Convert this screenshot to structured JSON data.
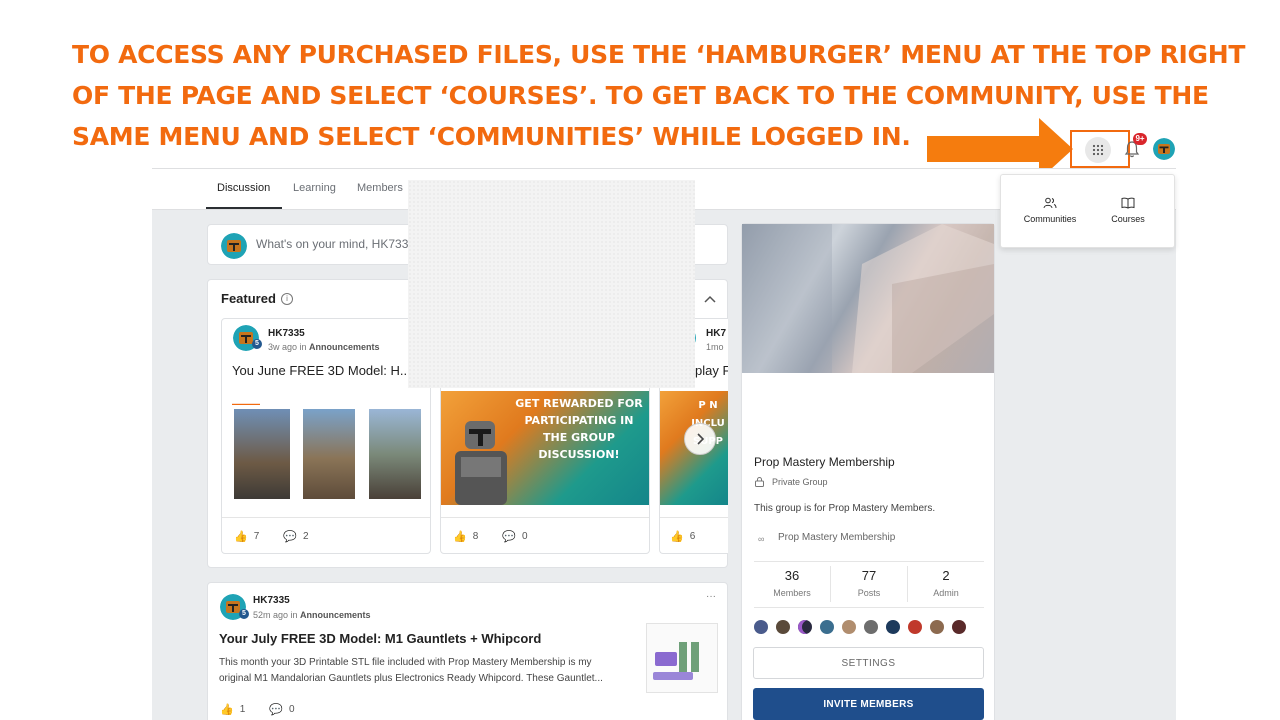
{
  "instruction": {
    "lines": [
      "TO ACCESS ANY PURCHASED FILES, USE THE ‘HAMBURGER’ MENU AT THE TOP RIGHT",
      "OF THE PAGE AND SELECT ‘COURSES’. TO GET BACK TO THE COMMUNITY, USE THE",
      "SAME MENU AND SELECT ‘COMMUNITIES’ WHILE LOGGED IN."
    ],
    "color": "#f26a0f"
  },
  "header": {
    "notification_count": "9+",
    "icons": [
      "apps-grid-icon",
      "bell-icon",
      "avatar"
    ]
  },
  "dropdown": {
    "items": [
      {
        "label": "Communities",
        "icon": "people-icon"
      },
      {
        "label": "Courses",
        "icon": "book-icon"
      }
    ]
  },
  "tabs": [
    {
      "label": "Discussion",
      "active": true
    },
    {
      "label": "Learning",
      "active": false
    },
    {
      "label": "Members",
      "active": false
    }
  ],
  "composer": {
    "placeholder": "What's on your mind, HK733"
  },
  "featured": {
    "title": "Featured",
    "cards": [
      {
        "author": "HK7335",
        "level": "5",
        "time": "3w ago in",
        "category": "Announcements",
        "title": "You June FREE 3D Model: H...",
        "likes": "7",
        "comments": "2"
      },
      {
        "author": "",
        "level": "",
        "time": "",
        "category": "",
        "title": "",
        "banner_text": "GET REWARDED FOR PARTICIPATING IN THE GROUP DISCUSSION!",
        "likes": "8",
        "comments": "0"
      },
      {
        "author": "HK7",
        "level": "",
        "time": "1mo",
        "category": "",
        "title": "play F",
        "banner_text": "P N INCLU SUPP",
        "likes": "6",
        "comments": ""
      }
    ]
  },
  "post": {
    "author": "HK7335",
    "level": "5",
    "time": "52m ago in",
    "category": "Announcements",
    "more": "···",
    "title": "Your July FREE 3D Model: M1 Gauntlets + Whipcord",
    "body_line1": "This month your 3D Printable STL file included with Prop Mastery Membership is my",
    "body_line2": "original M1 Mandalorian Gauntlets plus Electronics Ready Whipcord. These Gauntlet...",
    "likes": "1",
    "comments": "0"
  },
  "group": {
    "name": "Prop Mastery Membership",
    "privacy": "Private Group",
    "description": "This group is for Prop Mastery Members.",
    "link": "Prop Mastery Membership",
    "stats": [
      {
        "value": "36",
        "label": "Members"
      },
      {
        "value": "77",
        "label": "Posts"
      },
      {
        "value": "2",
        "label": "Admin"
      }
    ],
    "settings_label": "SETTINGS",
    "invite_label": "INVITE MEMBERS"
  }
}
